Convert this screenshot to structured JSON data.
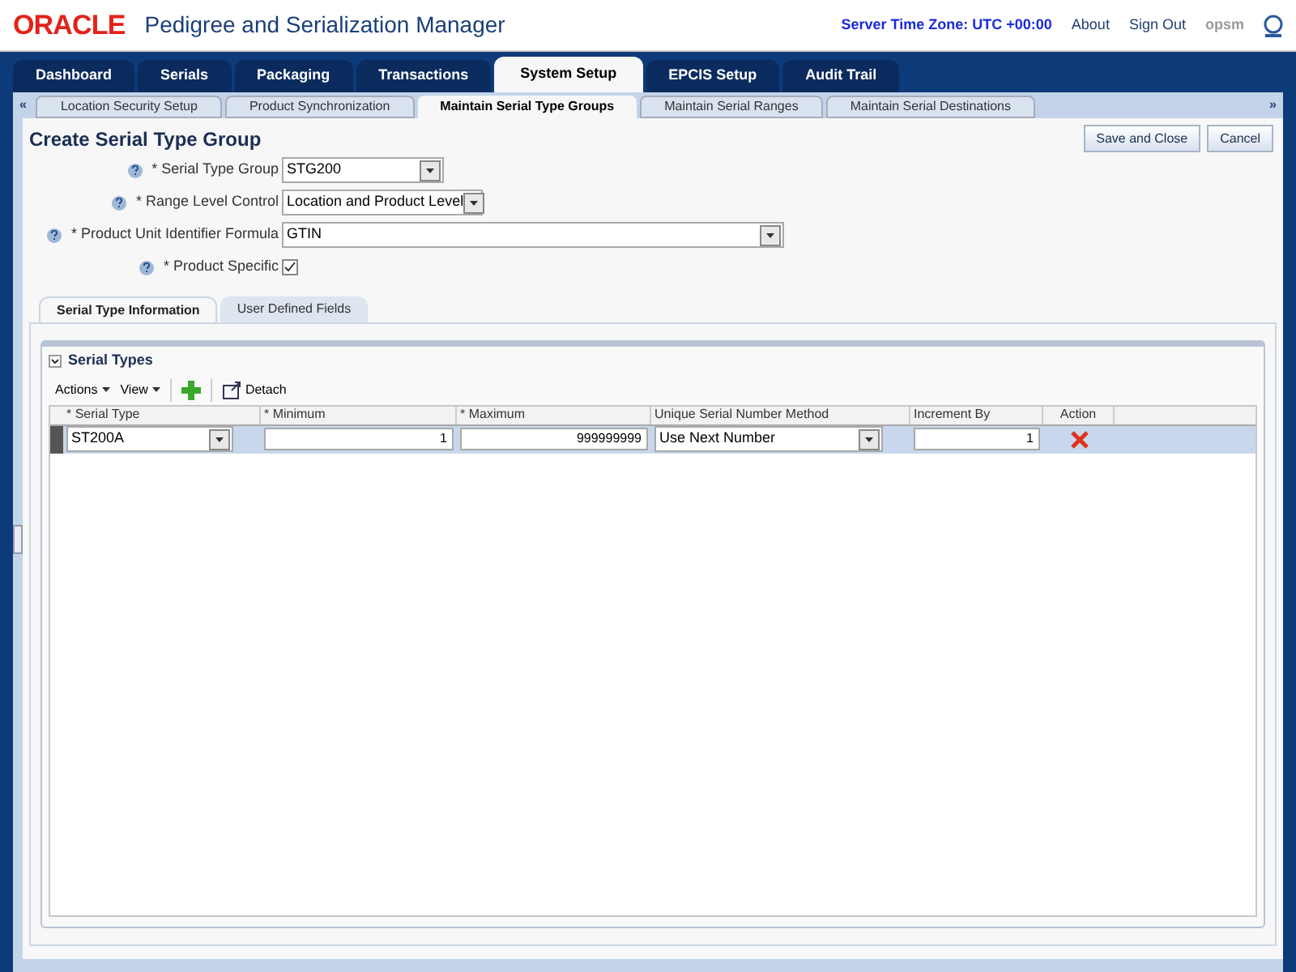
{
  "header": {
    "logo": "ORACLE",
    "app_title": "Pedigree and Serialization Manager",
    "server_time": "Server Time Zone: UTC +00:00",
    "links": [
      "About",
      "Sign Out"
    ],
    "user": "opsm"
  },
  "main_tabs": [
    {
      "label": "Dashboard",
      "selected": false
    },
    {
      "label": "Serials",
      "selected": false
    },
    {
      "label": "Packaging",
      "selected": false
    },
    {
      "label": "Transactions",
      "selected": false
    },
    {
      "label": "System Setup",
      "selected": true
    },
    {
      "label": "EPCIS Setup",
      "selected": false
    },
    {
      "label": "Audit Trail",
      "selected": false
    }
  ],
  "sub_tabs": {
    "scroll_left": "«",
    "scroll_right": "»",
    "items": [
      {
        "label": "Location Security Setup",
        "selected": false
      },
      {
        "label": "Product Synchronization",
        "selected": false
      },
      {
        "label": "Maintain Serial Type Groups",
        "selected": true
      },
      {
        "label": "Maintain Serial Ranges",
        "selected": false
      },
      {
        "label": "Maintain Serial Destinations",
        "selected": false
      }
    ]
  },
  "page_title": "Create Serial Type Group",
  "buttons": [
    "Save and Close",
    "Cancel"
  ],
  "form": [
    {
      "kind": "select",
      "label": "* Serial Type Group",
      "value": "STG200"
    },
    {
      "kind": "select",
      "label": "* Range Level Control",
      "value": "Location and Product Level"
    },
    {
      "kind": "select",
      "label": "* Product Unit Identifier Formula",
      "value": "GTIN"
    },
    {
      "kind": "checkbox",
      "label": "* Product Specific",
      "checked": true
    }
  ],
  "detail_tabs": [
    {
      "label": "Serial Type Information",
      "selected": true
    },
    {
      "label": "User Defined Fields",
      "selected": false
    }
  ],
  "serial_types": {
    "title": "Serial Types",
    "expanded": true,
    "menus": [
      "Actions",
      "View"
    ],
    "detach": "Detach",
    "columns": [
      "* Serial Type",
      "* Minimum",
      "* Maximum",
      "Unique Serial Number Method",
      "Increment By",
      "Action"
    ],
    "rows": [
      {
        "serial_type": "ST200A",
        "minimum": "1",
        "maximum": "999999999",
        "method": "Use Next Number",
        "increment": "1"
      }
    ]
  }
}
